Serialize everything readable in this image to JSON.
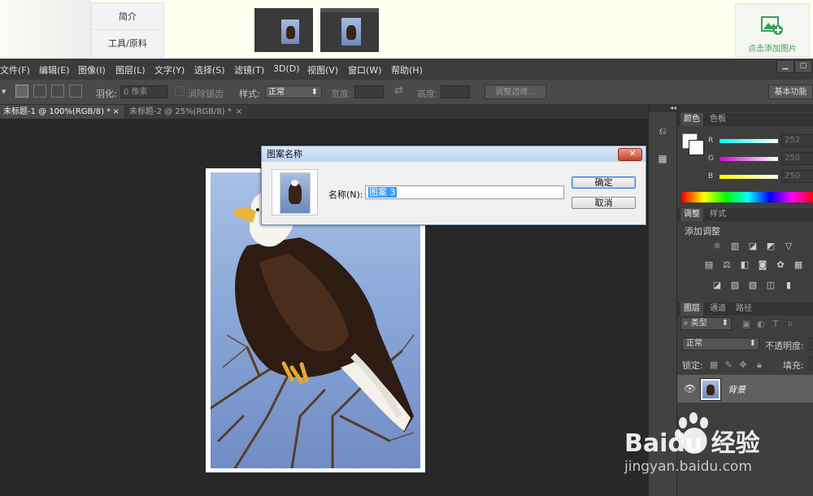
{
  "top_strip": {
    "tabs": [
      "简介",
      "工具/原料"
    ],
    "add_image_label": "点击添加图片"
  },
  "menu": {
    "items": [
      "文件(F)",
      "编辑(E)",
      "图像(I)",
      "图层(L)",
      "文字(Y)",
      "选择(S)",
      "滤镜(T)",
      "3D(D)",
      "视图(V)",
      "窗口(W)",
      "帮助(H)"
    ],
    "window_controls": [
      "▁",
      "▢",
      "✕"
    ]
  },
  "options_bar": {
    "feather_label": "羽化:",
    "feather_value": "0 像素",
    "antialias_label": "消除锯齿",
    "style_label": "样式:",
    "style_value": "正常",
    "width_label": "宽度:",
    "height_label": "高度:",
    "refine_edge_button": "调整边缘...",
    "workspace_button": "基本功能"
  },
  "doc_tabs": [
    {
      "label": "未标题-1 @ 100%(RGB/8) *",
      "close": "×"
    },
    {
      "label": "未标题-2 @ 25%(RGB/8) *",
      "close": "×"
    }
  ],
  "dialog": {
    "title": "图案名称",
    "close": "✕",
    "name_label": "名称(N):",
    "name_value": "图案 3",
    "ok_button": "确定",
    "cancel_button": "取消"
  },
  "color_panel": {
    "tabs": [
      "颜色",
      "色板"
    ],
    "channels": [
      {
        "label": "R",
        "value": "252"
      },
      {
        "label": "G",
        "value": "250"
      },
      {
        "label": "B",
        "value": "250"
      }
    ]
  },
  "adjust_panel": {
    "tabs": [
      "调整",
      "样式"
    ],
    "heading": "添加调整"
  },
  "layers_panel": {
    "tabs": [
      "图层",
      "通道",
      "路径"
    ],
    "filter_kind": "类型",
    "blend_mode": "正常",
    "opacity_label": "不透明度:",
    "lock_label": "锁定:",
    "fill_label": "填充:",
    "layer_name": "背景"
  },
  "watermark": {
    "brand": "Baidu 经验",
    "url": "jingyan.baidu.com"
  }
}
